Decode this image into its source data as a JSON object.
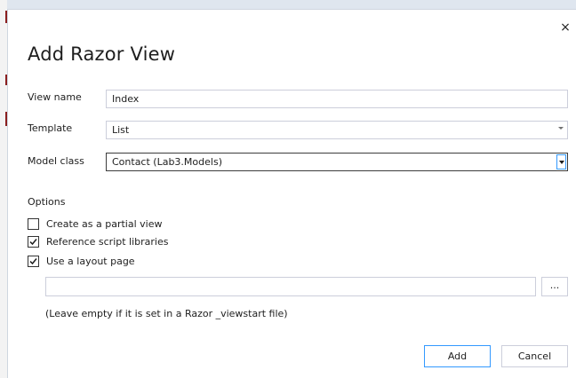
{
  "dialog": {
    "title": "Add Razor View",
    "close_glyph": "×"
  },
  "form": {
    "view_name_label": "View name",
    "view_name_value": "Index",
    "template_label": "Template",
    "template_value": "List",
    "model_class_label": "Model class",
    "model_class_value": "Contact (Lab3.Models)"
  },
  "options": {
    "heading": "Options",
    "items": [
      {
        "label": "Create as a partial view",
        "checked": false
      },
      {
        "label": "Reference script libraries",
        "checked": true
      },
      {
        "label": "Use a layout page",
        "checked": true
      }
    ],
    "layout_path_value": "",
    "browse_label": "...",
    "hint": "(Leave empty if it is set in a Razor _viewstart file)"
  },
  "buttons": {
    "add": "Add",
    "cancel": "Cancel"
  },
  "icons": {
    "close": "close-icon",
    "checkmark": "checkmark-icon",
    "dropdown": "chevron-down-icon"
  },
  "colors": {
    "accent": "#3399ff",
    "border": "#cccedb"
  }
}
